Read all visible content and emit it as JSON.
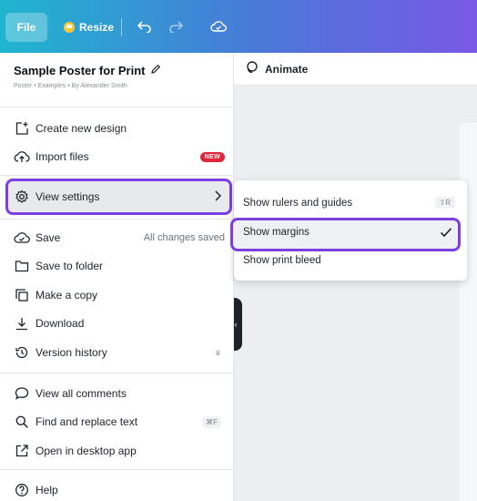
{
  "topbar": {
    "file_label": "File",
    "resize_label": "Resize",
    "undo_icon": "undo-icon",
    "redo_icon": "redo-icon",
    "cloud_icon": "cloud-check-icon"
  },
  "canvas": {
    "animate_label": "Animate"
  },
  "menu": {
    "title": "Sample Poster for Print",
    "subtitle": "Poster • Examples • By Alexander Smith",
    "items": [
      {
        "label": "Create new design",
        "icon": "plus-page-icon"
      },
      {
        "label": "Import files",
        "icon": "cloud-upload-icon",
        "badge": "NEW"
      },
      {
        "label": "View settings",
        "icon": "gear-icon"
      },
      {
        "label": "Save",
        "icon": "cloud-check-icon",
        "right": "All changes saved"
      },
      {
        "label": "Save to folder",
        "icon": "folder-icon"
      },
      {
        "label": "Make a copy",
        "icon": "copy-icon"
      },
      {
        "label": "Download",
        "icon": "download-icon"
      },
      {
        "label": "Version history",
        "icon": "history-icon"
      },
      {
        "label": "View all comments",
        "icon": "comment-icon"
      },
      {
        "label": "Find and replace text",
        "icon": "search-icon",
        "shortcut": "⌘F"
      },
      {
        "label": "Open in desktop app",
        "icon": "external-link-icon"
      },
      {
        "label": "Help",
        "icon": "help-icon"
      }
    ]
  },
  "submenu": {
    "items": [
      {
        "label": "Show rulers and guides",
        "shortcut": "⇧R"
      },
      {
        "label": "Show margins",
        "checked": true
      },
      {
        "label": "Show print bleed"
      }
    ]
  },
  "colors": {
    "highlight": "#7b3fe4",
    "badge": "#e0263a"
  }
}
